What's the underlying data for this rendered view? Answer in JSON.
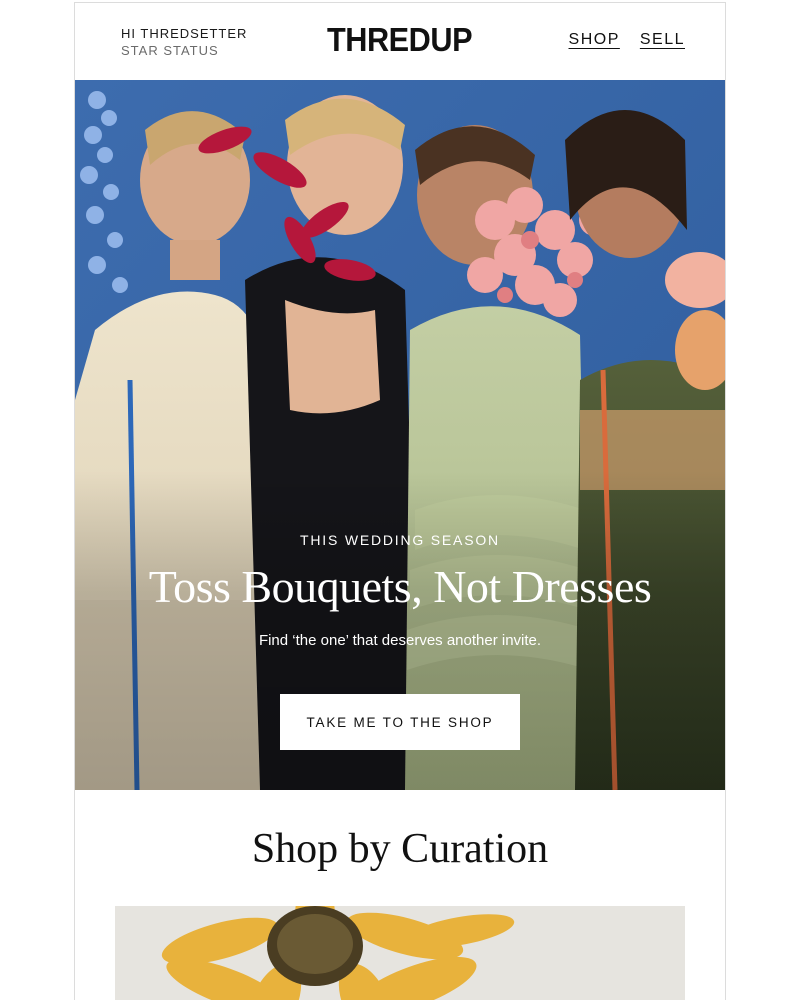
{
  "header": {
    "greeting": "HI THREDSETTER",
    "status": "STAR STATUS",
    "logo": "THREDUP",
    "nav": [
      {
        "label": "SHOP"
      },
      {
        "label": "SELL"
      }
    ]
  },
  "hero": {
    "eyebrow": "THIS WEDDING SEASON",
    "headline": "Toss Bouquets, Not Dresses",
    "subline": "Find ‘the one’ that deserves another invite.",
    "cta_label": "TAKE ME TO THE SHOP"
  },
  "curation": {
    "title": "Shop by Curation"
  },
  "colors": {
    "hero_sky": "#3f6fb0",
    "cream_dress": "#e9dfc6",
    "black_dress": "#141418",
    "sage_dress": "#b6c394",
    "olive_dress": "#3d4a2a",
    "sunflower": "#e8b23c"
  }
}
